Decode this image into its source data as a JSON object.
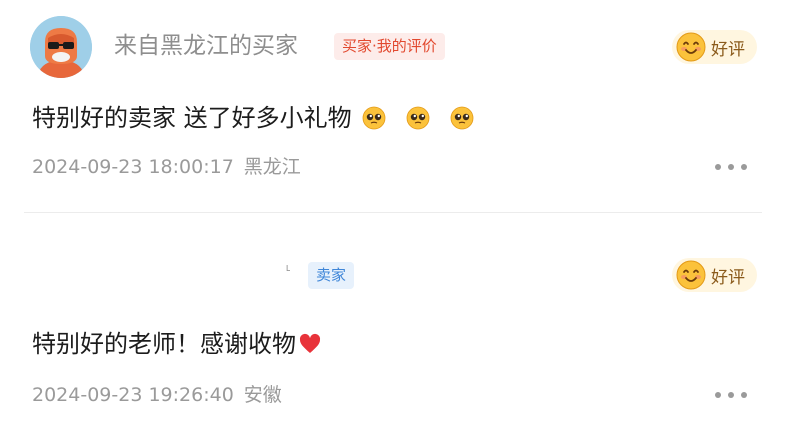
{
  "reviews": [
    {
      "reviewer": "来自黑龙江的买家",
      "role_tag": "买家·我的评价",
      "rating_label": "好评",
      "rating_icon": "smiling-face-icon",
      "content": "特别好的卖家 送了好多小礼物",
      "content_emojis": [
        "pleading-face-icon",
        "pleading-face-icon",
        "pleading-face-icon"
      ],
      "date": "2024-09-23 18:00:17",
      "location": "黑龙江"
    },
    {
      "reviewer": "",
      "role_tag": "卖家",
      "rating_label": "好评",
      "rating_icon": "smiling-face-icon",
      "content": "特别好的老师！感谢收物",
      "content_emojis": [
        "red-heart-icon"
      ],
      "date": "2024-09-23 19:26:40",
      "location": "安徽"
    }
  ],
  "colors": {
    "buyer_tag_bg": "#fdecea",
    "buyer_tag_text": "#e2492f",
    "seller_tag_bg": "#e7f1fc",
    "seller_tag_text": "#3f86d8",
    "rating_bg": "#fff6e0",
    "meta_text": "#9a9a9a"
  }
}
